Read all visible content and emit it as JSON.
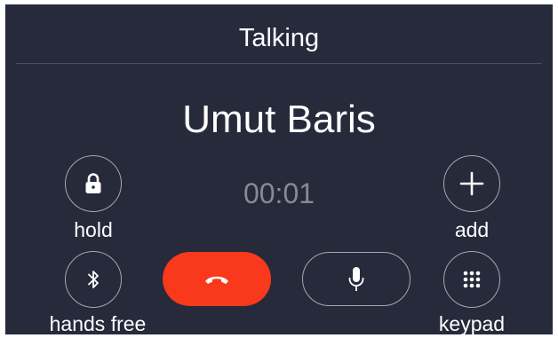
{
  "call": {
    "status": "Talking",
    "caller_name": "Umut Baris",
    "duration": "00:01"
  },
  "buttons": {
    "hold_label": "hold",
    "add_label": "add",
    "hands_free_label": "hands free",
    "keypad_label": "keypad"
  },
  "icons": {
    "hold": "lock-icon",
    "add": "plus-icon",
    "hands_free": "bluetooth-icon",
    "end_call": "phone-hangup-icon",
    "mute": "microphone-icon",
    "keypad": "keypad-icon"
  },
  "colors": {
    "background": "#262a3b",
    "end_call": "#f8391b",
    "timer_text": "#868a97",
    "outline": "#a3a7b3"
  }
}
